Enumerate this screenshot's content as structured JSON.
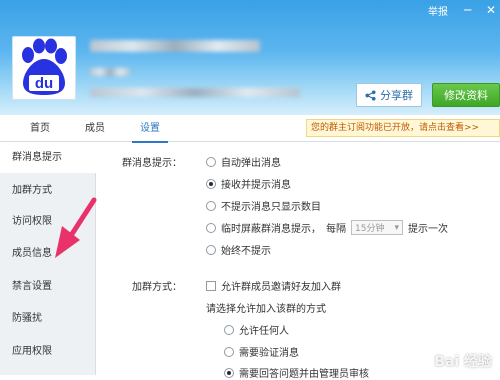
{
  "titlebar": {
    "report_label": "举报",
    "minimize": "─",
    "close": "✕"
  },
  "header": {
    "share_button": "分享群",
    "share_icon": "share-icon",
    "edit_button": "修改资料"
  },
  "tabs": [
    {
      "label": "首页"
    },
    {
      "label": "成员"
    },
    {
      "label": "设置"
    }
  ],
  "notice": {
    "text": "您的群主订阅功能已开放，请点击查看>>"
  },
  "sidebar": {
    "items": [
      {
        "label": "群消息提示"
      },
      {
        "label": "加群方式"
      },
      {
        "label": "访问权限"
      },
      {
        "label": "成员信息"
      },
      {
        "label": "禁言设置"
      },
      {
        "label": "防骚扰"
      },
      {
        "label": "应用权限"
      }
    ]
  },
  "message_settings": {
    "label": "群消息提示：",
    "options": [
      {
        "label": "自动弹出消息",
        "selected": false
      },
      {
        "label": "接收并提示消息",
        "selected": true
      },
      {
        "label": "不提示消息只显示数目",
        "selected": false
      },
      {
        "label": "临时屏蔽群消息提示，",
        "selected": false
      },
      {
        "label": "始终不提示",
        "selected": false
      }
    ],
    "interval_prefix": "每隔",
    "interval_value": "15分钟",
    "interval_suffix": "提示一次"
  },
  "join_settings": {
    "label": "加群方式：",
    "invite_checkbox": "允许群成员邀请好友加入群",
    "method_prompt": "请选择允许加入该群的方式",
    "options": [
      {
        "label": "允许任何人",
        "selected": false
      },
      {
        "label": "需要验证消息",
        "selected": false
      },
      {
        "label": "需要回答问题并由管理员审核",
        "selected": true
      }
    ]
  },
  "watermark": "Bai 经验",
  "colors": {
    "accent": "#2e79c4",
    "arrow": "#e8336a",
    "green": "#3fa628"
  }
}
